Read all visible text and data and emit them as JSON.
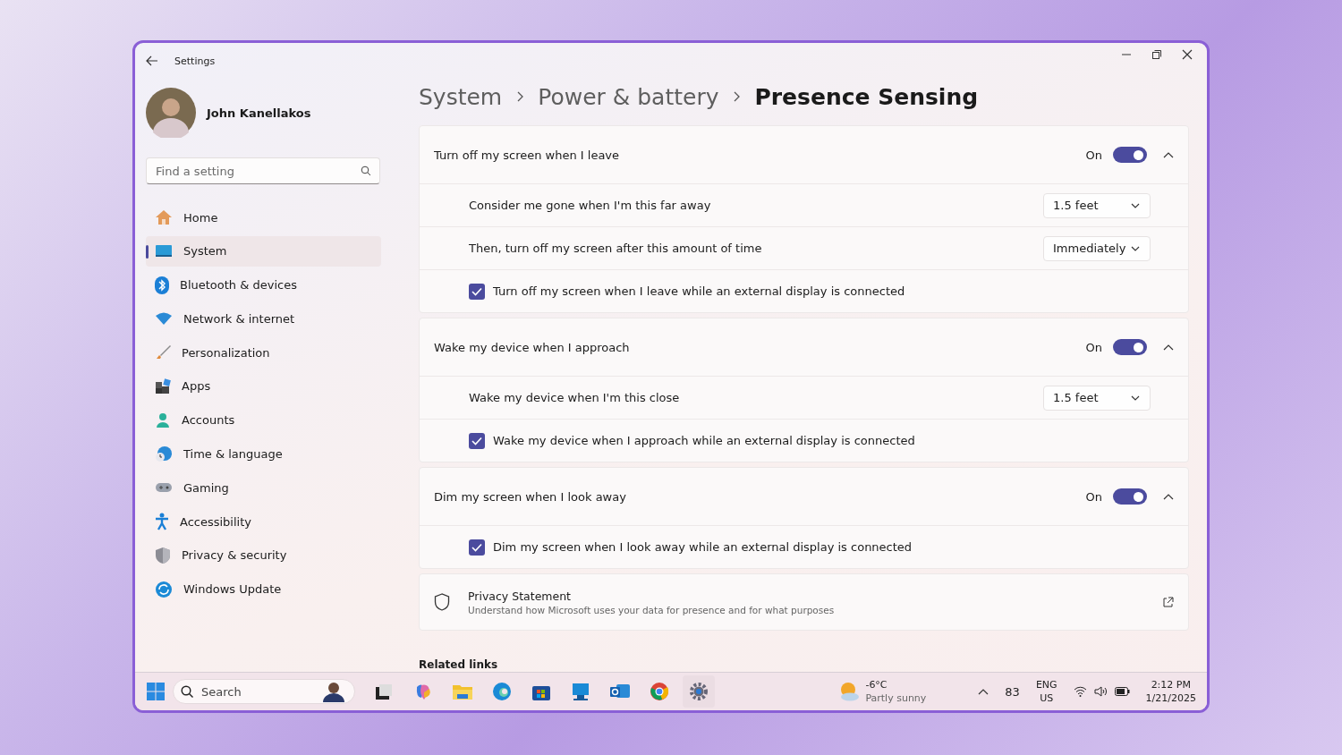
{
  "window": {
    "title": "Settings"
  },
  "user": {
    "name": "John Kanellakos"
  },
  "search": {
    "placeholder": "Find a setting"
  },
  "nav": [
    {
      "label": "Home",
      "selected": false
    },
    {
      "label": "System",
      "selected": true
    },
    {
      "label": "Bluetooth & devices",
      "selected": false
    },
    {
      "label": "Network & internet",
      "selected": false
    },
    {
      "label": "Personalization",
      "selected": false
    },
    {
      "label": "Apps",
      "selected": false
    },
    {
      "label": "Accounts",
      "selected": false
    },
    {
      "label": "Time & language",
      "selected": false
    },
    {
      "label": "Gaming",
      "selected": false
    },
    {
      "label": "Accessibility",
      "selected": false
    },
    {
      "label": "Privacy & security",
      "selected": false
    },
    {
      "label": "Windows Update",
      "selected": false
    }
  ],
  "breadcrumb": [
    "System",
    "Power & battery",
    "Presence Sensing"
  ],
  "sections": [
    {
      "title": "Turn off my screen when I leave",
      "state_label": "On",
      "on": true,
      "expanded": true,
      "rows": [
        {
          "kind": "dropdown",
          "label": "Consider me gone when I'm this far away",
          "value": "1.5 feet"
        },
        {
          "kind": "dropdown",
          "label": "Then, turn off my screen after this amount of time",
          "value": "Immediately"
        },
        {
          "kind": "checkbox",
          "label": "Turn off my screen when I leave while an external display is connected",
          "checked": true
        }
      ]
    },
    {
      "title": "Wake my device when I approach",
      "state_label": "On",
      "on": true,
      "expanded": true,
      "rows": [
        {
          "kind": "dropdown",
          "label": "Wake my device when I'm this close",
          "value": "1.5 feet"
        },
        {
          "kind": "checkbox",
          "label": "Wake my device when I approach while an external display is connected",
          "checked": true
        }
      ]
    },
    {
      "title": "Dim my screen when I look away",
      "state_label": "On",
      "on": true,
      "expanded": true,
      "rows": [
        {
          "kind": "checkbox",
          "label": "Dim my screen when I look away while an external display is connected",
          "checked": true
        }
      ]
    }
  ],
  "privacy": {
    "title": "Privacy Statement",
    "description": "Understand how Microsoft uses your data for presence and for what purposes"
  },
  "related_links": "Related links",
  "taskbar": {
    "search_placeholder": "Search",
    "weather": {
      "temperature": "-6°C",
      "condition": "Partly sunny"
    },
    "badge": "83",
    "language": "ENG",
    "region": "US",
    "time": "2:12 PM",
    "date": "1/21/2025"
  }
}
